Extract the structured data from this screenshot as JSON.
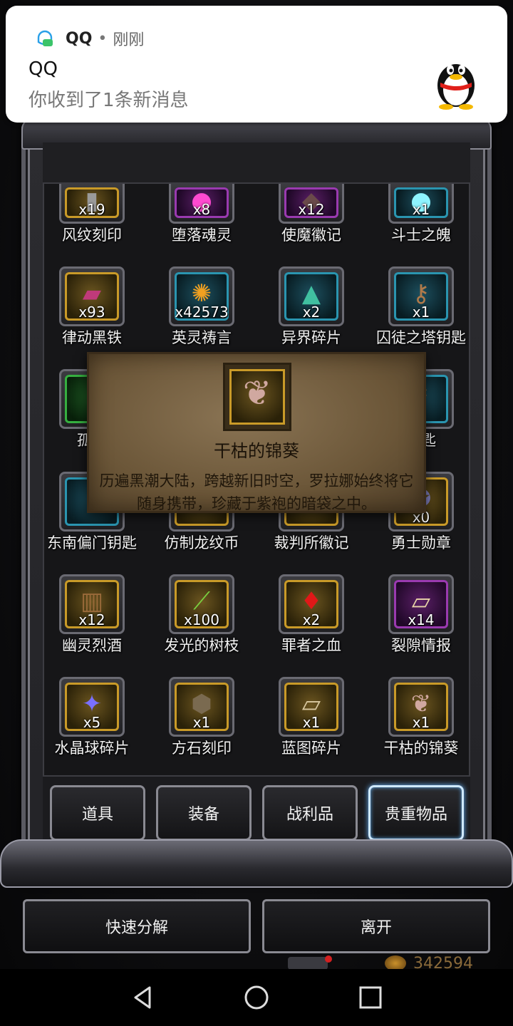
{
  "notification": {
    "app_name": "QQ",
    "separator": "•",
    "time": "刚刚",
    "title": "QQ",
    "message": "你收到了1条新消息",
    "icons": [
      "qq-app-icon",
      "qq-penguin-icon"
    ]
  },
  "items": [
    {
      "name": "风纹刻印",
      "count": "x19",
      "frame": "gold",
      "icon": "rune-icon"
    },
    {
      "name": "堕落魂灵",
      "count": "x8",
      "frame": "purple",
      "icon": "soul-orb-icon"
    },
    {
      "name": "使魔徽记",
      "count": "x12",
      "frame": "purple",
      "icon": "emblem-icon"
    },
    {
      "name": "斗士之魄",
      "count": "x1",
      "frame": "blue",
      "icon": "spirit-orb-icon"
    },
    {
      "name": "律动黑铁",
      "count": "x93",
      "frame": "gold",
      "icon": "black-iron-icon"
    },
    {
      "name": "英灵祷言",
      "count": "x42573",
      "frame": "blue",
      "icon": "prayer-orb-icon"
    },
    {
      "name": "异界碎片",
      "count": "x2",
      "frame": "blue",
      "icon": "shard-icon"
    },
    {
      "name": "囚徒之塔钥匙",
      "count": "x1",
      "frame": "blue",
      "icon": "key-icon"
    },
    {
      "name": "孤塔",
      "count": "",
      "frame": "green",
      "icon": "key-icon"
    },
    {
      "name": "钥匙",
      "count": "",
      "frame": "blue",
      "icon": "key-icon"
    },
    {
      "name": "东南偏门钥匙",
      "count": "",
      "frame": "blue",
      "icon": "key-icon"
    },
    {
      "name": "仿制龙纹币",
      "count": "",
      "frame": "gold",
      "icon": "coin-icon"
    },
    {
      "name": "裁判所徽记",
      "count": "",
      "frame": "gold",
      "icon": "emblem-icon"
    },
    {
      "name": "勇士勋章",
      "count": "x0",
      "frame": "gold",
      "icon": "medal-icon"
    },
    {
      "name": "幽灵烈酒",
      "count": "x12",
      "frame": "gold",
      "icon": "barrel-icon"
    },
    {
      "name": "发光的树枝",
      "count": "x100",
      "frame": "gold",
      "icon": "branch-icon"
    },
    {
      "name": "罪者之血",
      "count": "x2",
      "frame": "gold",
      "icon": "blood-drop-icon"
    },
    {
      "name": "裂隙情报",
      "count": "x14",
      "frame": "purple",
      "icon": "scroll-icon"
    },
    {
      "name": "水晶球碎片",
      "count": "x5",
      "frame": "gold",
      "icon": "crystal-icon"
    },
    {
      "name": "方石刻印",
      "count": "x1",
      "frame": "gold",
      "icon": "stone-icon"
    },
    {
      "name": "蓝图碎片",
      "count": "x1",
      "frame": "gold",
      "icon": "blueprint-icon"
    },
    {
      "name": "干枯的锦葵",
      "count": "x1",
      "frame": "gold",
      "icon": "withered-leaf-icon"
    }
  ],
  "tooltip": {
    "name": "干枯的锦葵",
    "description": "历遍黑潮大陆，跨越新旧时空，罗拉娜始终将它随身携带，珍藏于紫袍的暗袋之中。",
    "icon": "withered-leaf-icon"
  },
  "tabs": [
    {
      "label": "道具",
      "active": false
    },
    {
      "label": "装备",
      "active": false
    },
    {
      "label": "战利品",
      "active": false
    },
    {
      "label": "贵重物品",
      "active": true
    }
  ],
  "buttons": {
    "quick_decompose": "快速分解",
    "leave": "离开"
  },
  "currency": {
    "gold": "342594"
  },
  "nav": [
    "back-icon",
    "home-icon",
    "recents-icon"
  ],
  "colors": {
    "gold_frame": "#c99a28",
    "purple_frame": "#9a3ab0",
    "blue_frame": "#2a95b0",
    "green_frame": "#36b040",
    "active_tab_glow": "#6bb8ff"
  }
}
